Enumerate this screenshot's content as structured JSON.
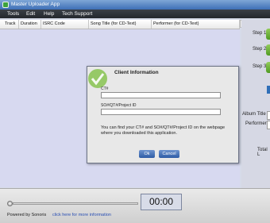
{
  "window": {
    "title": "Master Uploader App"
  },
  "menu": [
    "Tools",
    "Edit",
    "Help",
    "Tech Support"
  ],
  "table": {
    "headers": [
      "Track",
      "Duration",
      "ISRC Code",
      "Song Title (for CD-Text)",
      "Performer (for CD-Text)"
    ]
  },
  "right_panel": {
    "steps": [
      "Step 1",
      "Step 2",
      "Step 3"
    ],
    "album_title_label": "Album Title",
    "performer_label": "Performer:",
    "total_label": "Total L"
  },
  "dialog": {
    "title": "Client Information",
    "ct_label": "CT#",
    "ct_value": "",
    "so_label": "SO#/QT#/Project ID",
    "so_value": "",
    "info_text": "You can find your CT# and SO#/QT#/Project ID on the webpage where you downloaded this application.",
    "ok_label": "Ok",
    "cancel_label": "Cancel"
  },
  "player": {
    "time": "00:00",
    "progress": 0
  },
  "footer": {
    "powered_text": "Powered by Sonoris",
    "link_text": "click here for more information"
  },
  "colors": {
    "accent_blue": "#2d5ba6",
    "step_green": "#4f9a22",
    "table_bg": "#d7d9f0"
  },
  "icons": [
    "app-icon",
    "check-icon",
    "play-icon",
    "pause-icon",
    "stop-icon"
  ]
}
